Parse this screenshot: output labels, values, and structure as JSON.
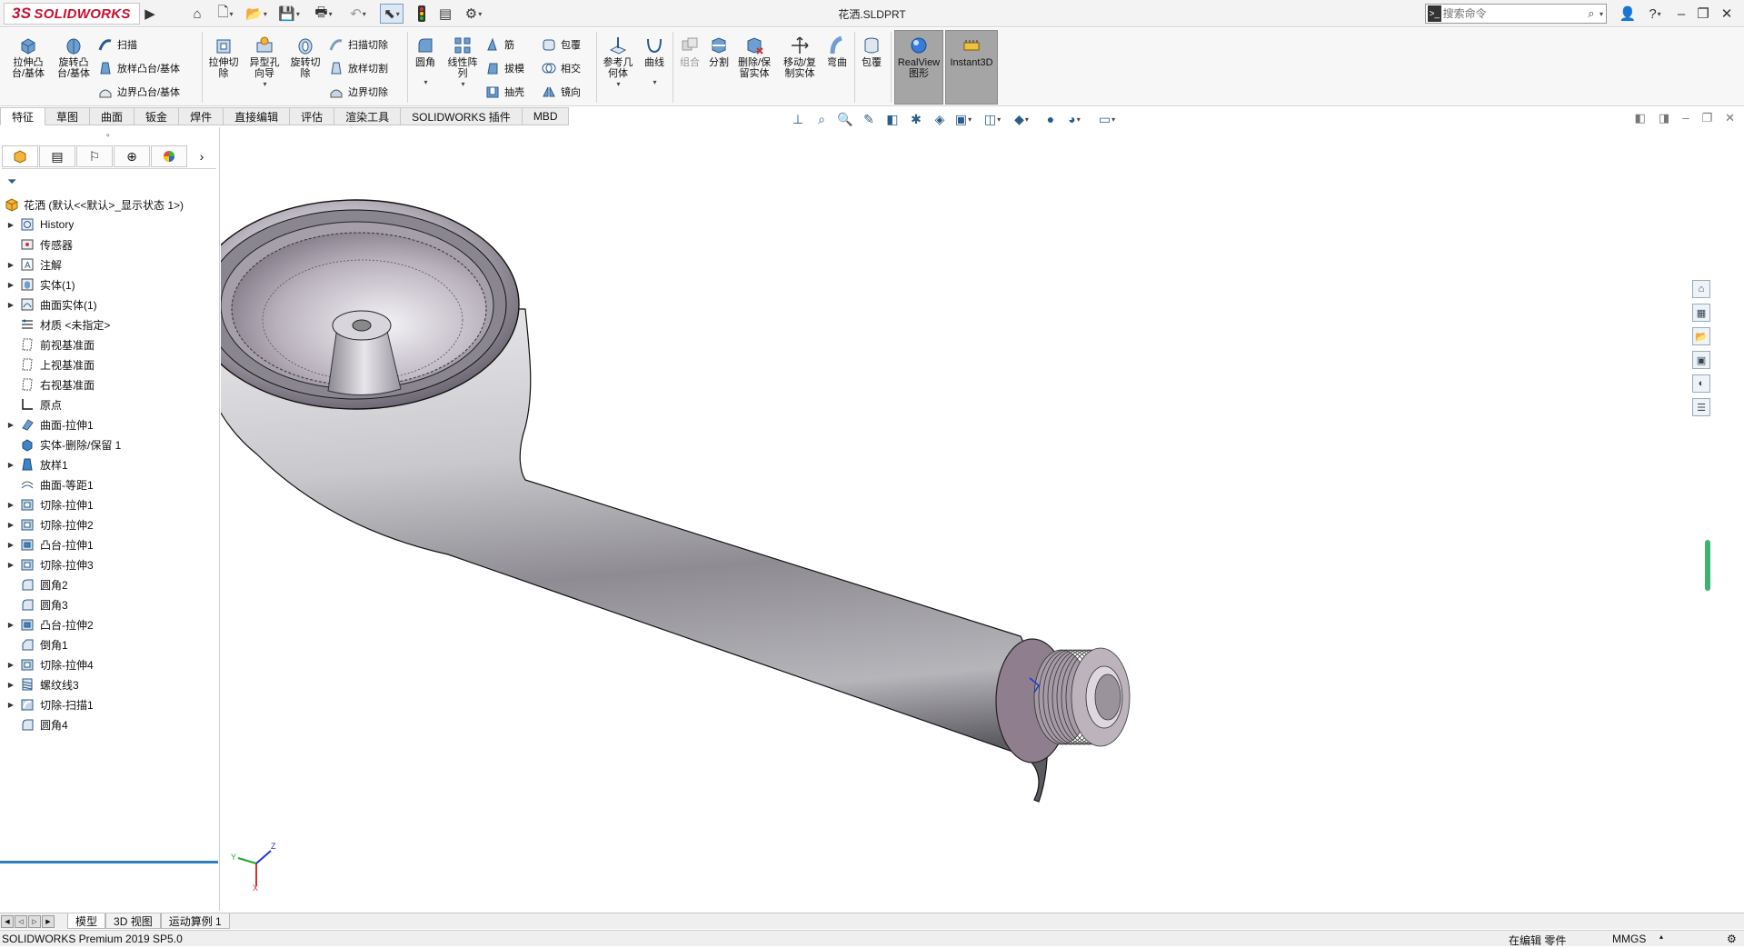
{
  "title_bar": {
    "logo_text": "SOLIDWORKS",
    "document_title": "花洒.SLDPRT",
    "search_placeholder": "搜索命令"
  },
  "ribbon": {
    "extrude_boss": "拉伸凸\n台/基体",
    "revolve_boss": "旋转凸\n台/基体",
    "sweep": "扫描",
    "loft_boss": "放样凸台/基体",
    "boundary_boss": "边界凸台/基体",
    "extrude_cut": "拉伸切\n除",
    "hole_wizard": "异型孔\n向导",
    "revolve_cut": "旋转切\n除",
    "swept_cut": "扫描切除",
    "lofted_cut": "放样切割",
    "boundary_cut": "边界切除",
    "fillet": "圆角",
    "linear_pattern": "线性阵\n列",
    "rib": "筋",
    "draft": "拔模",
    "shell": "抽壳",
    "wrap": "包覆",
    "intersect": "相交",
    "mirror": "镜向",
    "ref_geometry": "参考几\n何体",
    "curves": "曲线",
    "combine": "组合",
    "split": "分割",
    "delete_keep_body": "删除/保\n留实体",
    "move_copy_body": "移动/复\n制实体",
    "flex": "弯曲",
    "wrap2": "包覆",
    "realview": "RealView\n图形",
    "instant3d": "Instant3D"
  },
  "tabs": [
    "特征",
    "草图",
    "曲面",
    "钣金",
    "焊件",
    "直接编辑",
    "评估",
    "渲染工具",
    "SOLIDWORKS 插件",
    "MBD"
  ],
  "tree": {
    "root": "花洒 (默认<<默认>_显示状态 1>)",
    "items": [
      {
        "label": "History",
        "expand": true,
        "icon": "history-icon"
      },
      {
        "label": "传感器",
        "expand": false,
        "icon": "sensors-icon"
      },
      {
        "label": "注解",
        "expand": true,
        "icon": "annotations-icon"
      },
      {
        "label": "实体(1)",
        "expand": true,
        "icon": "solid-bodies-icon"
      },
      {
        "label": "曲面实体(1)",
        "expand": true,
        "icon": "surface-bodies-icon"
      },
      {
        "label": "材质 <未指定>",
        "expand": false,
        "icon": "material-icon"
      },
      {
        "label": "前视基准面",
        "expand": false,
        "icon": "plane-icon"
      },
      {
        "label": "上视基准面",
        "expand": false,
        "icon": "plane-icon"
      },
      {
        "label": "右视基准面",
        "expand": false,
        "icon": "plane-icon"
      },
      {
        "label": "原点",
        "expand": false,
        "icon": "origin-icon"
      },
      {
        "label": "曲面-拉伸1",
        "expand": true,
        "icon": "surface-extrude-icon"
      },
      {
        "label": "实体-删除/保留 1",
        "expand": false,
        "icon": "delete-body-icon"
      },
      {
        "label": "放样1",
        "expand": true,
        "icon": "loft-icon"
      },
      {
        "label": "曲面-等距1",
        "expand": false,
        "icon": "surface-offset-icon"
      },
      {
        "label": "切除-拉伸1",
        "expand": true,
        "icon": "cut-extrude-icon"
      },
      {
        "label": "切除-拉伸2",
        "expand": true,
        "icon": "cut-extrude-icon"
      },
      {
        "label": "凸台-拉伸1",
        "expand": true,
        "icon": "boss-extrude-icon"
      },
      {
        "label": "切除-拉伸3",
        "expand": true,
        "icon": "cut-extrude-icon"
      },
      {
        "label": "圆角2",
        "expand": false,
        "icon": "fillet-icon"
      },
      {
        "label": "圆角3",
        "expand": false,
        "icon": "fillet-icon"
      },
      {
        "label": "凸台-拉伸2",
        "expand": true,
        "icon": "boss-extrude-icon"
      },
      {
        "label": "倒角1",
        "expand": false,
        "icon": "chamfer-icon"
      },
      {
        "label": "切除-拉伸4",
        "expand": true,
        "icon": "cut-extrude-icon"
      },
      {
        "label": "螺纹线3",
        "expand": true,
        "icon": "thread-icon"
      },
      {
        "label": "切除-扫描1",
        "expand": true,
        "icon": "cut-sweep-icon"
      },
      {
        "label": "圆角4",
        "expand": false,
        "icon": "fillet-icon"
      }
    ]
  },
  "bottom_tabs": [
    "模型",
    "3D 视图",
    "运动算例 1"
  ],
  "status": {
    "product": "SOLIDWORKS Premium 2019 SP5.0",
    "editing": "在编辑 零件",
    "units": "MMGS"
  },
  "triad": {
    "x": "X",
    "y": "Y",
    "z": "Z"
  },
  "colors": {
    "brand_red": "#c8102e",
    "tree_accent": "#2e7fc1",
    "highlight_button": "#a5a5a5"
  }
}
